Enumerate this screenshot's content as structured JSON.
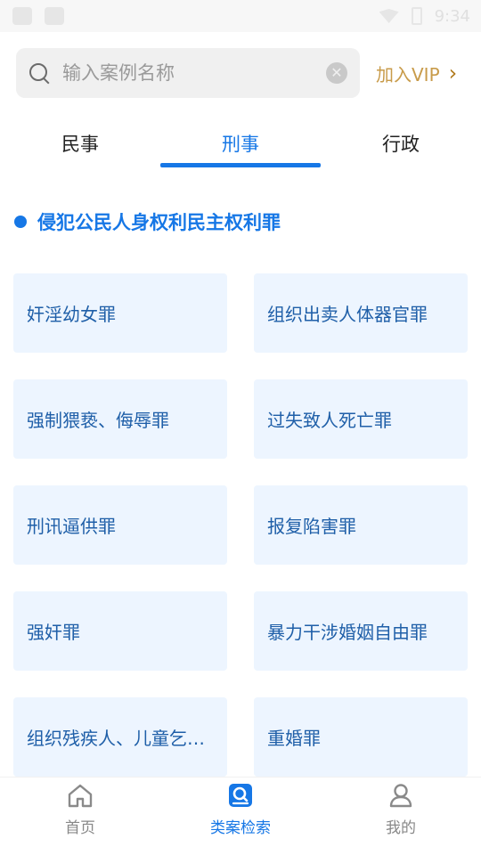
{
  "status_bar": {
    "time": "9:34"
  },
  "search": {
    "placeholder": "输入案例名称",
    "value": ""
  },
  "vip": {
    "label": "加入VIP"
  },
  "tabs": [
    {
      "label": "民事",
      "active": false
    },
    {
      "label": "刑事",
      "active": true
    },
    {
      "label": "行政",
      "active": false
    }
  ],
  "section": {
    "title": "侵犯公民人身权利民主权利罪"
  },
  "cards": [
    "奸淫幼女罪",
    "组织出卖人体器官罪",
    "强制猥亵、侮辱罪",
    "过失致人死亡罪",
    "刑讯逼供罪",
    "报复陷害罪",
    "强奸罪",
    "暴力干涉婚姻自由罪",
    "组织残疾人、儿童乞…",
    "重婚罪"
  ],
  "bottom_nav": [
    {
      "label": "首页",
      "icon": "home-icon",
      "active": false
    },
    {
      "label": "类案检索",
      "icon": "case-search-icon",
      "active": true
    },
    {
      "label": "我的",
      "icon": "profile-icon",
      "active": false
    }
  ],
  "colors": {
    "accent": "#1677e6",
    "vip": "#c89b4a",
    "card_bg": "#edf5ff"
  }
}
